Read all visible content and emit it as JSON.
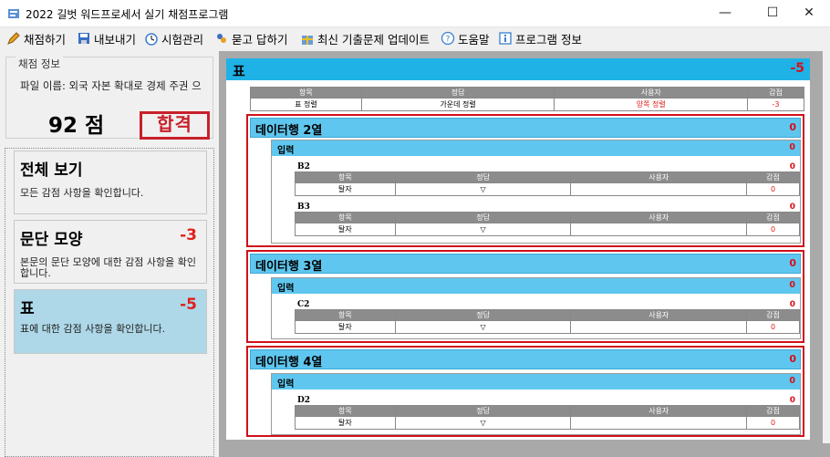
{
  "window": {
    "title": "2022 길벗 워드프로세서 실기 채점프로그램",
    "minimize": "—",
    "maximize": "☐",
    "close": "✕"
  },
  "menu": [
    {
      "label": "채점하기",
      "icon": "pencil-icon"
    },
    {
      "label": "내보내기",
      "icon": "save-icon"
    },
    {
      "label": "시험관리",
      "icon": "timer-icon"
    },
    {
      "label": "묻고 답하기",
      "icon": "qa-icon"
    },
    {
      "label": "최신 기출문제 업데이트",
      "icon": "gift-icon"
    },
    {
      "label": "도움말",
      "icon": "help-icon"
    },
    {
      "label": "프로그램 정보",
      "icon": "info-icon"
    }
  ],
  "score_panel": {
    "group_label": "채점 정보",
    "file_name": "파일 이름: 외국 자본 확대로 경제 주권 으",
    "score": "92 점",
    "stamp": "합격"
  },
  "categories": [
    {
      "title": "전체 보기",
      "score": "",
      "desc": "모든 감점 사항을 확인합니다."
    },
    {
      "title": "문단 모양",
      "score": "-3",
      "desc": "본문의 문단 모양에 대한 감점 사항을 확인합니다."
    },
    {
      "title": "표",
      "score": "-5",
      "desc": "표에 대한 감점 사항을 확인합니다."
    }
  ],
  "section": {
    "title": "표",
    "score": "-5",
    "headers": [
      "항목",
      "정답",
      "사용자",
      "감점"
    ],
    "summary_row": [
      "표 정렬",
      "가운데 정렬",
      "양쪽 정렬",
      "-3"
    ],
    "rows": [
      {
        "title": "데이터행 2열",
        "score": "0",
        "input_title": "입력",
        "input_score": "0",
        "cells": [
          {
            "name": "B2",
            "score": "0",
            "row": [
              "탈자",
              "▽",
              "",
              "0"
            ]
          },
          {
            "name": "B3",
            "score": "0",
            "row": [
              "탈자",
              "▽",
              "",
              "0"
            ]
          }
        ]
      },
      {
        "title": "데이터행 3열",
        "score": "0",
        "input_title": "입력",
        "input_score": "0",
        "cells": [
          {
            "name": "C2",
            "score": "0",
            "row": [
              "탈자",
              "▽",
              "",
              "0"
            ]
          }
        ]
      },
      {
        "title": "데이터행 4열",
        "score": "0",
        "input_title": "입력",
        "input_score": "0",
        "cells": [
          {
            "name": "D2",
            "score": "0",
            "row": [
              "탈자",
              "▽",
              "",
              "0"
            ]
          }
        ]
      }
    ]
  },
  "colors": {
    "section_head": "#1fb2e6",
    "sub_head": "#5fc7ef",
    "penalty": "#e0201a",
    "active_card": "#aed8e8"
  }
}
